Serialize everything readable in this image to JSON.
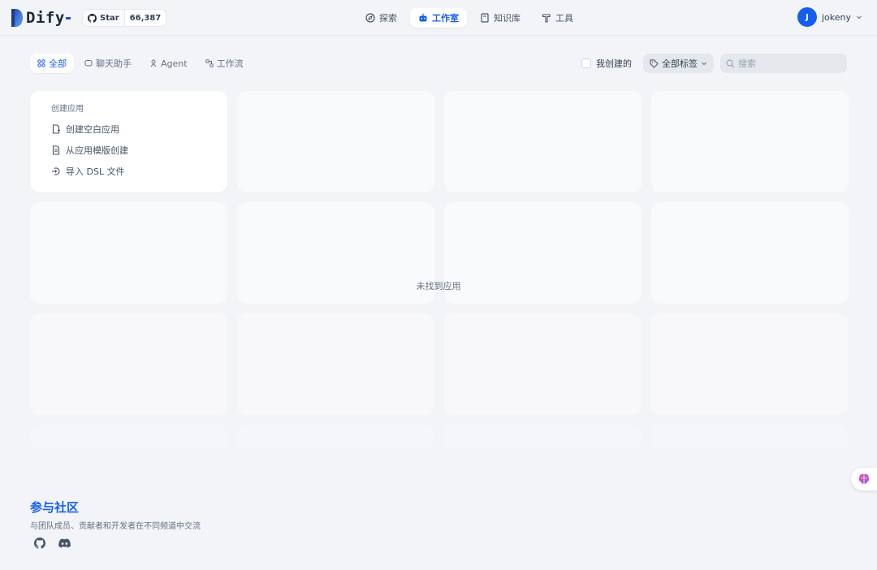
{
  "header": {
    "logo_text": "Dify",
    "github": {
      "star_label": "Star",
      "star_count": "66,387"
    },
    "nav": [
      {
        "label": "探索",
        "active": false
      },
      {
        "label": "工作室",
        "active": true
      },
      {
        "label": "知识库",
        "active": false
      },
      {
        "label": "工具",
        "active": false
      }
    ],
    "user": {
      "avatar_letter": "J",
      "name": "jokeny"
    }
  },
  "filters": {
    "tabs": [
      {
        "label": "全部",
        "active": true
      },
      {
        "label": "聊天助手",
        "active": false
      },
      {
        "label": "Agent",
        "active": false
      },
      {
        "label": "工作流",
        "active": false
      }
    ],
    "mine_label": "我创建的",
    "tags_label": "全部标签",
    "search_placeholder": "搜索"
  },
  "create_card": {
    "title": "创建应用",
    "items": [
      {
        "label": "创建空白应用"
      },
      {
        "label": "从应用模版创建"
      },
      {
        "label": "导入 DSL 文件"
      }
    ]
  },
  "empty_message": "未找到应用",
  "community": {
    "title": "参与社区",
    "description": "与团队成员、贡献者和开发者在不同频道中交流"
  },
  "colors": {
    "accent": "#155eef",
    "background": "#f2f4f7"
  }
}
